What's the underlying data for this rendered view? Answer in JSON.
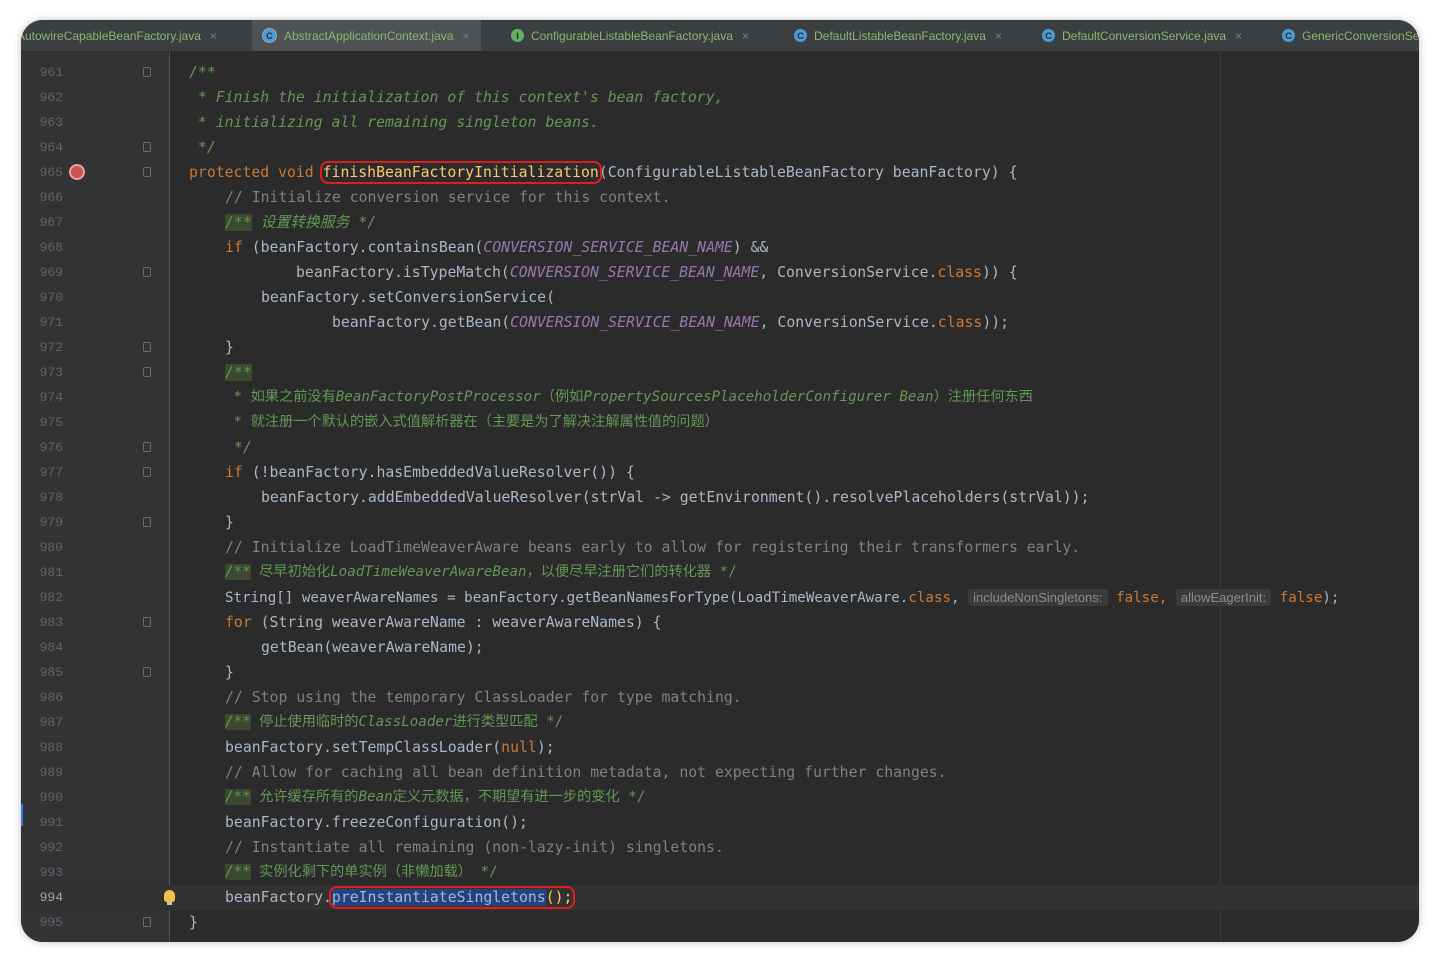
{
  "tabs": [
    {
      "label": "AutowireCapableBeanFactory.java",
      "icon": "interface-icon",
      "active": false
    },
    {
      "label": "AbstractApplicationContext.java",
      "icon": "abstract-class-icon",
      "active": true
    },
    {
      "label": "ConfigurableListableBeanFactory.java",
      "icon": "interface-icon",
      "active": false
    },
    {
      "label": "DefaultListableBeanFactory.java",
      "icon": "class-icon",
      "active": false
    },
    {
      "label": "DefaultConversionService.java",
      "icon": "class-icon",
      "active": false
    },
    {
      "label": "GenericConversionService.java",
      "icon": "class-icon",
      "active": false
    }
  ],
  "close_glyph": "×",
  "editor": {
    "current_line": "994",
    "line_numbers": [
      "961",
      "962",
      "963",
      "964",
      "965",
      "966",
      "967",
      "968",
      "969",
      "970",
      "971",
      "972",
      "973",
      "974",
      "975",
      "976",
      "977",
      "978",
      "979",
      "980",
      "981",
      "982",
      "983",
      "984",
      "985",
      "986",
      "987",
      "988",
      "989",
      "990",
      "991",
      "992",
      "993",
      "994",
      "995"
    ],
    "tokens": {
      "l961": "/**",
      "l962": " * Finish the initialization of this context's bean factory,",
      "l963": " * initializing all remaining singleton beans.",
      "l964": " */",
      "l965_kw": "protected void ",
      "l965_fn": "finishBeanFactoryInitialization",
      "l965_rest": "(ConfigurableListableBeanFactory beanFactory) {",
      "l966": "// Initialize conversion service for this context.",
      "l967_tag": "/**",
      "l967_rest": " 设置转换服务 */",
      "l968_kw": "if",
      "l968_a": " (beanFactory.containsBean(",
      "l968_c": "CONVERSION_SERVICE_BEAN_NAME",
      "l968_b": ") &&",
      "l969_a": "beanFactory.isTypeMatch(",
      "l969_c": "CONVERSION_SERVICE_BEAN_NAME",
      "l969_b": ", ConversionService.",
      "l969_kw": "class",
      "l969_d": ")) {",
      "l970": "beanFactory.setConversionService(",
      "l971_a": "beanFactory.getBean(",
      "l971_c": "CONVERSION_SERVICE_BEAN_NAME",
      "l971_b": ", ConversionService.",
      "l971_kw": "class",
      "l971_d": "));",
      "l972": "}",
      "l973_tag": "/**",
      "l974_a": " * 如果之前没有",
      "l974_b": "BeanFactoryPostProcessor",
      "l974_c": "（例如",
      "l974_d": "PropertySourcesPlaceholderConfigurer Bean",
      "l974_e": "）注册任何东西",
      "l975": " * 就注册一个默认的嵌入式值解析器在（主要是为了解决注解属性值的问题）",
      "l976": " */",
      "l977_kw": "if",
      "l977_rest": " (!beanFactory.hasEmbeddedValueResolver()) {",
      "l978": "beanFactory.addEmbeddedValueResolver(strVal -> getEnvironment().resolvePlaceholders(strVal));",
      "l979": "}",
      "l980": "// Initialize LoadTimeWeaverAware beans early to allow for registering their transformers early.",
      "l981_tag": "/**",
      "l981_a": " 尽早初始化",
      "l981_b": "LoadTimeWeaverAwareBean",
      "l981_c": "，以便尽早注册它们的转化器 */",
      "l982_a": "String[] weaverAwareNames = beanFactory.getBeanNamesForType(LoadTimeWeaverAware.",
      "l982_kw": "class",
      "l982_b": ", ",
      "l982_hint1": "includeNonSingletons:",
      "l982_f1": " false",
      "l982_c": ", ",
      "l982_hint2": "allowEagerInit:",
      "l982_f2": " false",
      "l982_d": ");",
      "l983_kw": "for",
      "l983_rest": " (String weaverAwareName : weaverAwareNames) {",
      "l984": "getBean(weaverAwareName);",
      "l985": "}",
      "l986": "// Stop using the temporary ClassLoader for type matching.",
      "l987_tag": "/**",
      "l987_a": " 停止使用临时的",
      "l987_b": "ClassLoader",
      "l987_c": "进行类型匹配 */",
      "l988_a": "beanFactory.setTempClassLoader(",
      "l988_kw": "null",
      "l988_b": ");",
      "l989": "// Allow for caching all bean definition metadata, not expecting further changes.",
      "l990_tag": "/**",
      "l990_a": " 允许缓存所有的",
      "l990_b": "Bean",
      "l990_c": "定义元数据，不期望有进一步的变化 */",
      "l991": "beanFactory.freezeConfiguration();",
      "l992": "// Instantiate all remaining (non-lazy-init) singletons.",
      "l993_tag": "/**",
      "l993_rest": " 实例化剩下的单实例（非懒加载） */",
      "l994_a": "beanFactory.",
      "l994_fn": "preInstantiateSingletons",
      "l994_b": "();",
      "l995": "}"
    }
  },
  "colors": {
    "background": "#2b2b2b",
    "gutter": "#313335",
    "keyword": "#cc7832",
    "comment": "#808080",
    "doc_comment": "#629755",
    "constant": "#9876aa",
    "highlight_box": "#e01d1d",
    "selection": "#214283"
  }
}
